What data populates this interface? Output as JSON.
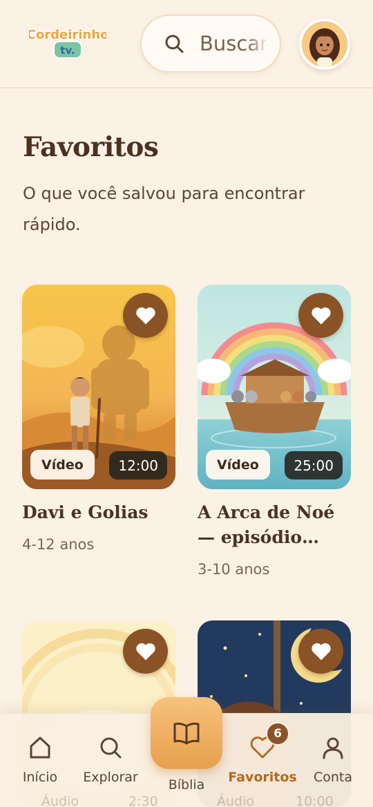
{
  "header": {
    "logo_text_top": "Cordeirinho",
    "logo_text_bottom": "tv.",
    "search_placeholder": "Buscar",
    "avatar_icon": "girl-avatar"
  },
  "page": {
    "title": "Favoritos",
    "subtitle": "O que você salvou para encontrar rápido."
  },
  "cards": [
    {
      "title": "Davi e Golias",
      "age": "4-12 anos",
      "type": "Vídeo",
      "duration": "12:00",
      "favorited": true
    },
    {
      "title": "A Arca de Noé — episódio…",
      "age": "3-10 anos",
      "type": "Vídeo",
      "duration": "25:00",
      "favorited": true
    },
    {
      "title": "",
      "age": "",
      "type": "Áudio",
      "duration": "2:30",
      "favorited": true
    },
    {
      "title": "",
      "age": "",
      "type": "Áudio",
      "duration": "10:00",
      "favorited": true
    }
  ],
  "nav": {
    "items": [
      {
        "label": "Início",
        "icon": "home-icon"
      },
      {
        "label": "Explorar",
        "icon": "search-icon"
      },
      {
        "label": "Bíblia",
        "icon": "book-icon"
      },
      {
        "label": "Favoritos",
        "icon": "heart-icon",
        "active": true,
        "badge": "6"
      },
      {
        "label": "Conta",
        "icon": "user-icon"
      }
    ]
  },
  "colors": {
    "background": "#fbf1e5",
    "accent": "#8a5326",
    "active_nav": "#b46a1e",
    "fab": "#e7a04e"
  }
}
